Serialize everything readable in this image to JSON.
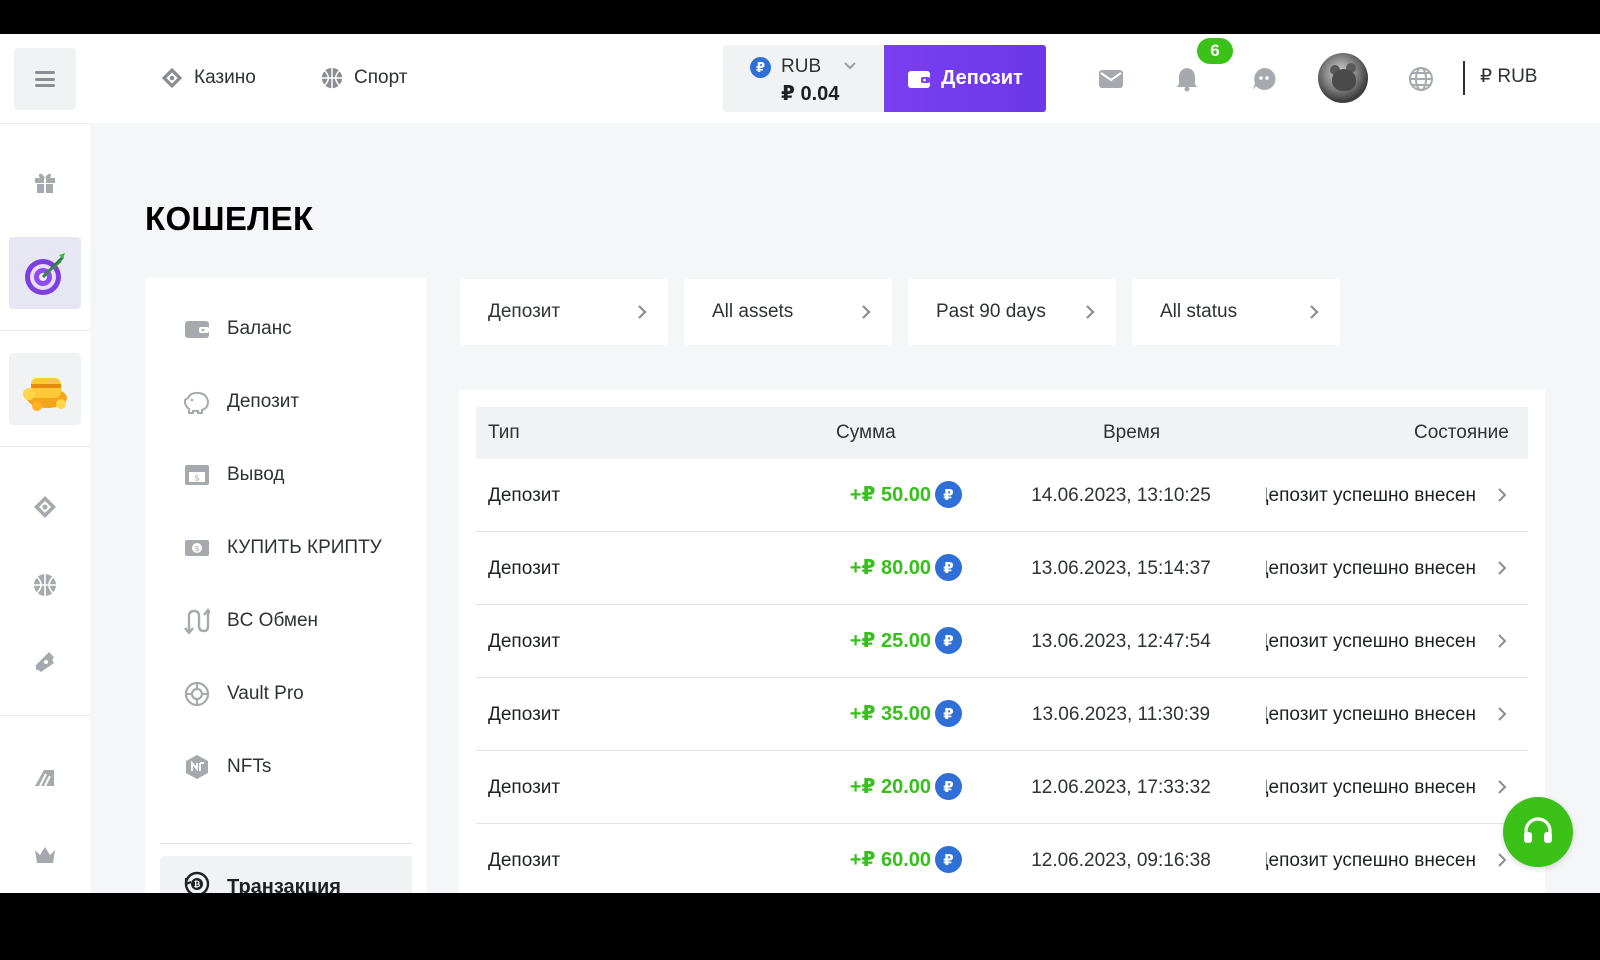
{
  "header": {
    "nav": [
      {
        "label": "Казино",
        "icon": "casino-icon"
      },
      {
        "label": "Спорт",
        "icon": "sport-icon"
      }
    ],
    "balance": {
      "currency": "RUB",
      "coin_symbol": "₽",
      "amount": "₽ 0.04"
    },
    "deposit_button": "Депозит",
    "notification_count": "6",
    "currency_label": "₽ RUB",
    "colors": {
      "accent": "#7a3ff0",
      "success": "#3bc117",
      "coin": "#2f6fd6"
    }
  },
  "page_title": "КОШЕЛЕК",
  "wallet_menu": {
    "items": [
      {
        "label": "Баланс",
        "icon": "wallet-icon"
      },
      {
        "label": "Депозит",
        "icon": "piggy-bank-icon"
      },
      {
        "label": "Вывод",
        "icon": "withdraw-icon"
      },
      {
        "label": "КУПИТЬ КРИПТУ",
        "icon": "buy-crypto-icon"
      },
      {
        "label": "BC Обмен",
        "icon": "swap-icon"
      },
      {
        "label": "Vault Pro",
        "icon": "vault-icon"
      },
      {
        "label": "NFTs",
        "icon": "nft-icon"
      }
    ],
    "active": {
      "label": "Транзакция",
      "icon": "transaction-icon"
    }
  },
  "filters": [
    {
      "label": "Депозит"
    },
    {
      "label": "All assets"
    },
    {
      "label": "Past 90 days"
    },
    {
      "label": "All status"
    }
  ],
  "table": {
    "columns": [
      "Тип",
      "Сумма",
      "Время",
      "Состояние"
    ],
    "rows": [
      {
        "type": "Депозит",
        "amount": "+₽ 50.00",
        "coin": "₽",
        "time": "14.06.2023, 13:10:25",
        "status": "Депозит успешно внесен"
      },
      {
        "type": "Депозит",
        "amount": "+₽ 80.00",
        "coin": "₽",
        "time": "13.06.2023, 15:14:37",
        "status": "Депозит успешно внесен"
      },
      {
        "type": "Депозит",
        "amount": "+₽ 25.00",
        "coin": "₽",
        "time": "13.06.2023, 12:47:54",
        "status": "Депозит успешно внесен"
      },
      {
        "type": "Депозит",
        "amount": "+₽ 35.00",
        "coin": "₽",
        "time": "13.06.2023, 11:30:39",
        "status": "Депозит успешно внесен"
      },
      {
        "type": "Депозит",
        "amount": "+₽ 20.00",
        "coin": "₽",
        "time": "12.06.2023, 17:33:32",
        "status": "Депозит успешно внесен"
      },
      {
        "type": "Депозит",
        "amount": "+₽ 60.00",
        "coin": "₽",
        "time": "12.06.2023, 09:16:38",
        "status": "Депозит успешно внесен"
      }
    ]
  }
}
